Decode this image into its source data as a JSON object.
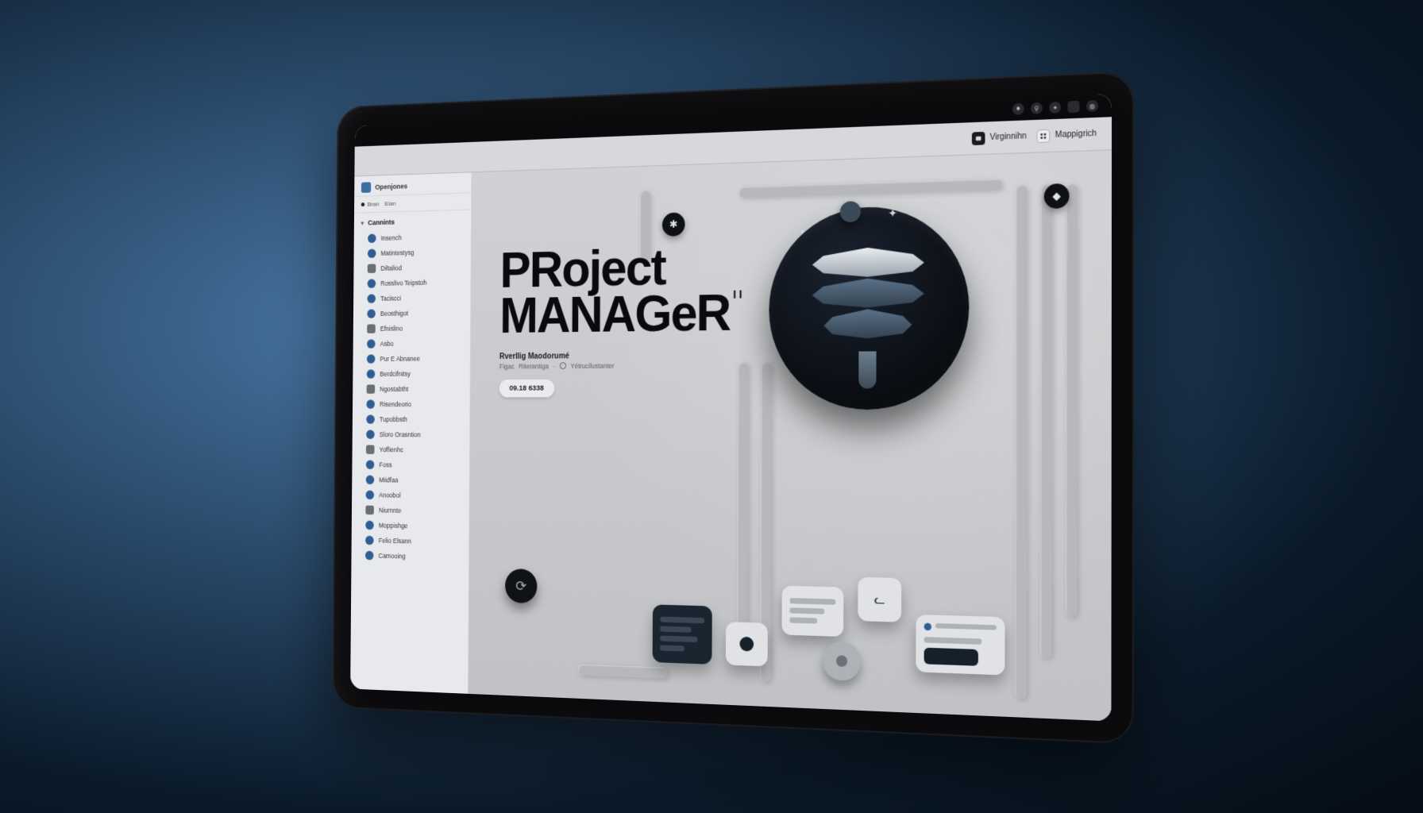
{
  "statusbar": {
    "right_icons": [
      "camera",
      "pin",
      "gear",
      "shield",
      "user"
    ]
  },
  "subheader": {
    "left_chip": {
      "icon": "camera",
      "label": "Virginnihn"
    },
    "right_chip": {
      "icon": "grid",
      "label": "Mappigrich"
    }
  },
  "sidebar": {
    "workspace": "Openjones",
    "row2_a": "Bran",
    "row2_b": "Eian",
    "section_label": "Cannints",
    "items": [
      "Insench",
      "Matintestysg",
      "Diltaliod",
      "Rosslivo Teipstoh",
      "Taciscci",
      "Beosthigot",
      "Efnislino",
      "Asbo",
      "Pur E Abnanee",
      "Berdcifnitsy",
      "Ngostabtht",
      "Risendeorio",
      "Tupobbsth",
      "Sloro Orasntion",
      "Yoffienhc",
      "Foss",
      "Miidfaa",
      "Anoobol",
      "Niurnnte",
      "Moppishge",
      "Felio Elsann",
      "Camooing"
    ]
  },
  "hero": {
    "title_line1": "PRoject",
    "title_line2": "MANAGeR",
    "mark": "I I",
    "meta_line1": "Rverllig Maodorumé",
    "meta_line2_a": "Figac",
    "meta_line2_b": "Riterantiga",
    "meta_line2_c": "Yétrucilustanter",
    "date_chip": "09.18 6338"
  },
  "decor": {
    "node_gear": "✱",
    "node_drop": "◆",
    "node_refresh": "↻",
    "knob_left": "⟳",
    "cat_icon": "ᓚ"
  },
  "colors": {
    "bg_start": "#4a7aa8",
    "bg_end": "#050d15",
    "device": "#0a0a0c",
    "screen": "#c7c9cc",
    "sidebar": "#e7e9ec",
    "accent_blue": "#2e5e94",
    "logo_dark": "#0a0d12"
  }
}
